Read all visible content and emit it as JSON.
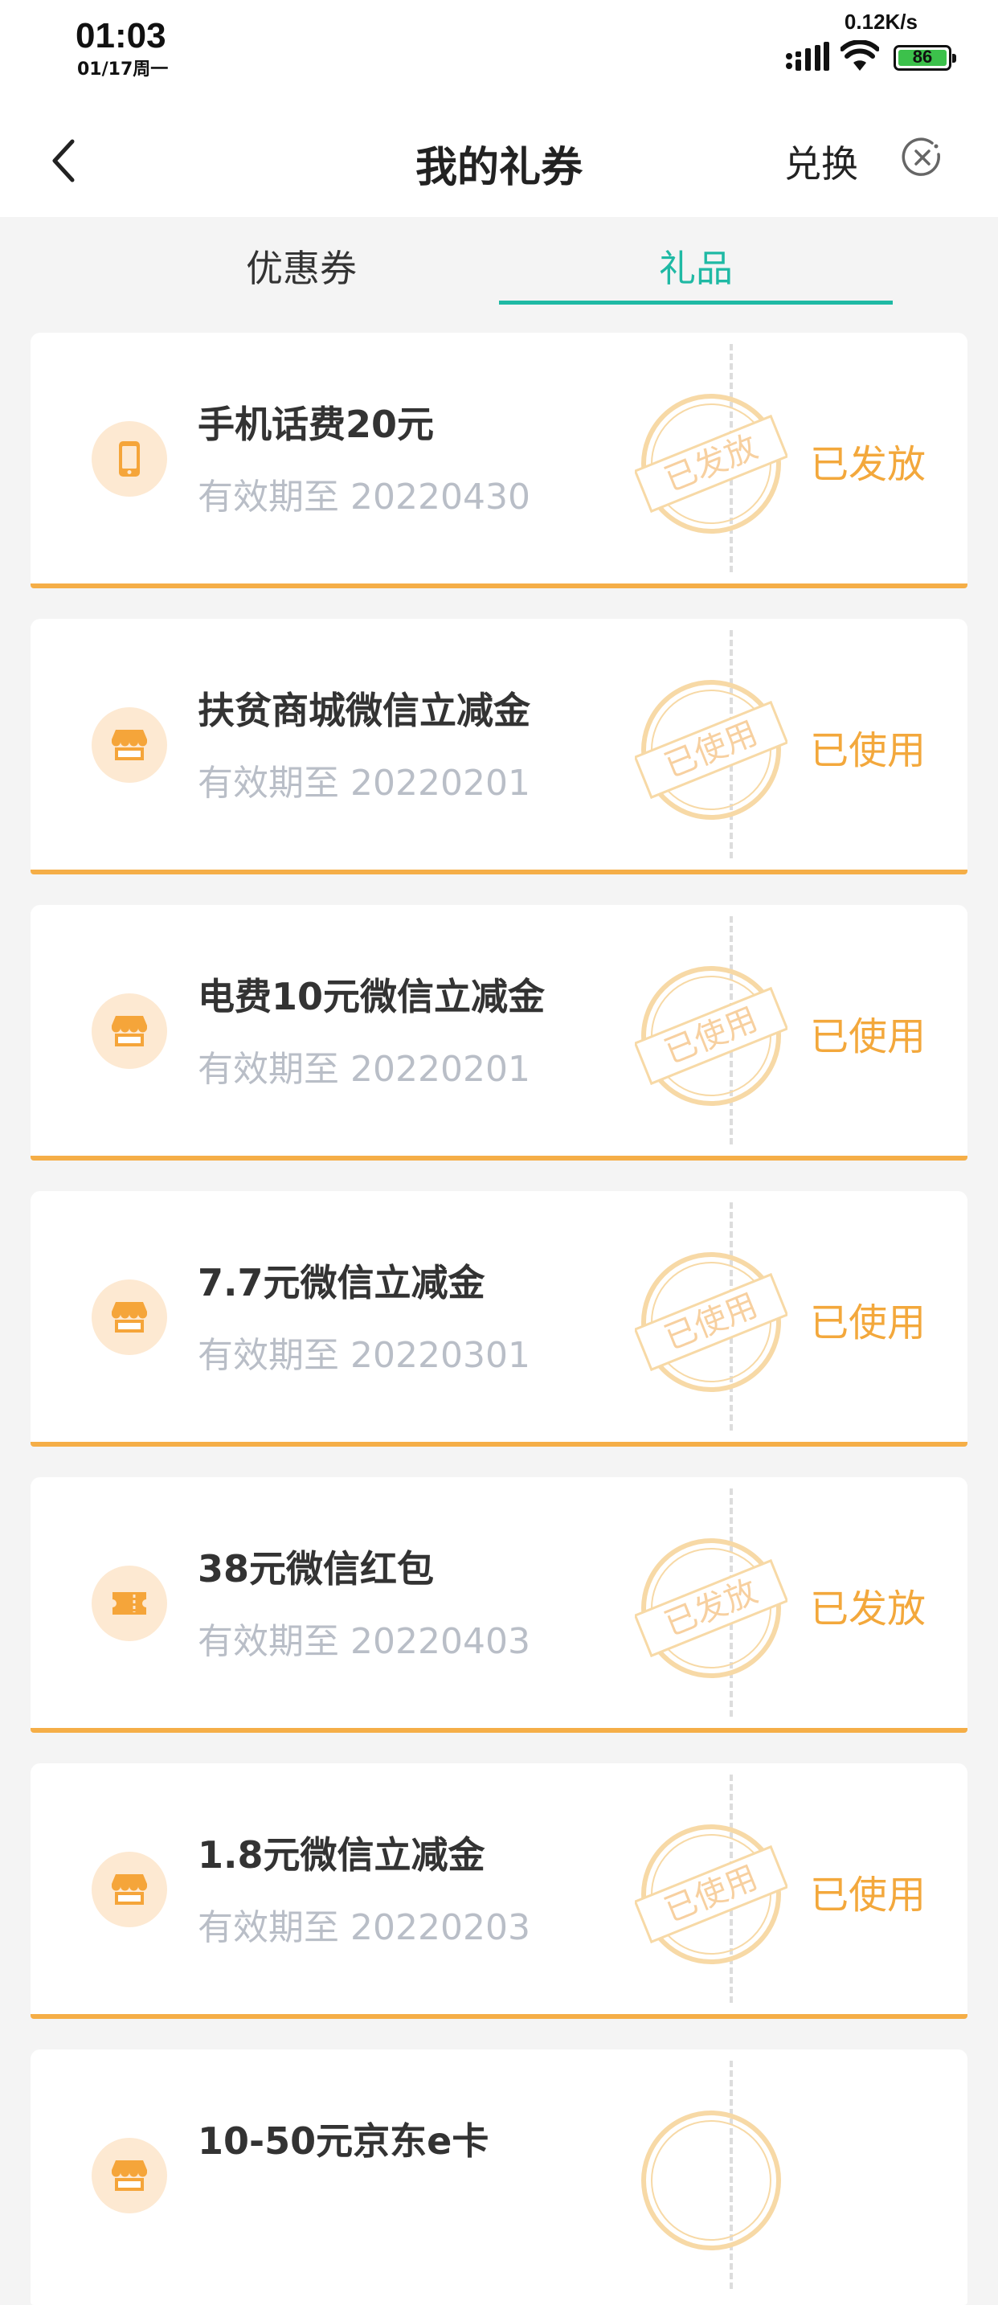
{
  "status_bar": {
    "time": "01:03",
    "date": "01/17周一",
    "network_speed": "0.12K/s",
    "battery": "86"
  },
  "navbar": {
    "title": "我的礼券",
    "redeem_label": "兑换"
  },
  "tabs": [
    {
      "label": "优惠券",
      "active": false
    },
    {
      "label": "礼品",
      "active": true
    }
  ],
  "gifts": [
    {
      "name": "手机话费20元",
      "validity": "有效期至 20220430",
      "status": "已发放",
      "stamp": "已发放",
      "icon": "phone-icon"
    },
    {
      "name": "扶贫商城微信立减金",
      "validity": "有效期至 20220201",
      "status": "已使用",
      "stamp": "已使用",
      "icon": "store-icon"
    },
    {
      "name": "电费10元微信立减金",
      "validity": "有效期至 20220201",
      "status": "已使用",
      "stamp": "已使用",
      "icon": "store-icon"
    },
    {
      "name": "7.7元微信立减金",
      "validity": "有效期至 20220301",
      "status": "已使用",
      "stamp": "已使用",
      "icon": "store-icon"
    },
    {
      "name": "38元微信红包",
      "validity": "有效期至 20220403",
      "status": "已发放",
      "stamp": "已发放",
      "icon": "ticket-icon"
    },
    {
      "name": "1.8元微信立减金",
      "validity": "有效期至 20220203",
      "status": "已使用",
      "stamp": "已使用",
      "icon": "store-icon"
    },
    {
      "name": "10-50元京东e卡",
      "validity": "",
      "status": "",
      "stamp": "",
      "icon": "store-icon"
    }
  ],
  "colors": {
    "accent": "#1fb9a4",
    "status_orange": "#f3a83c",
    "icon_orange": "#f5a53a",
    "icon_bg": "#fde9d2"
  }
}
